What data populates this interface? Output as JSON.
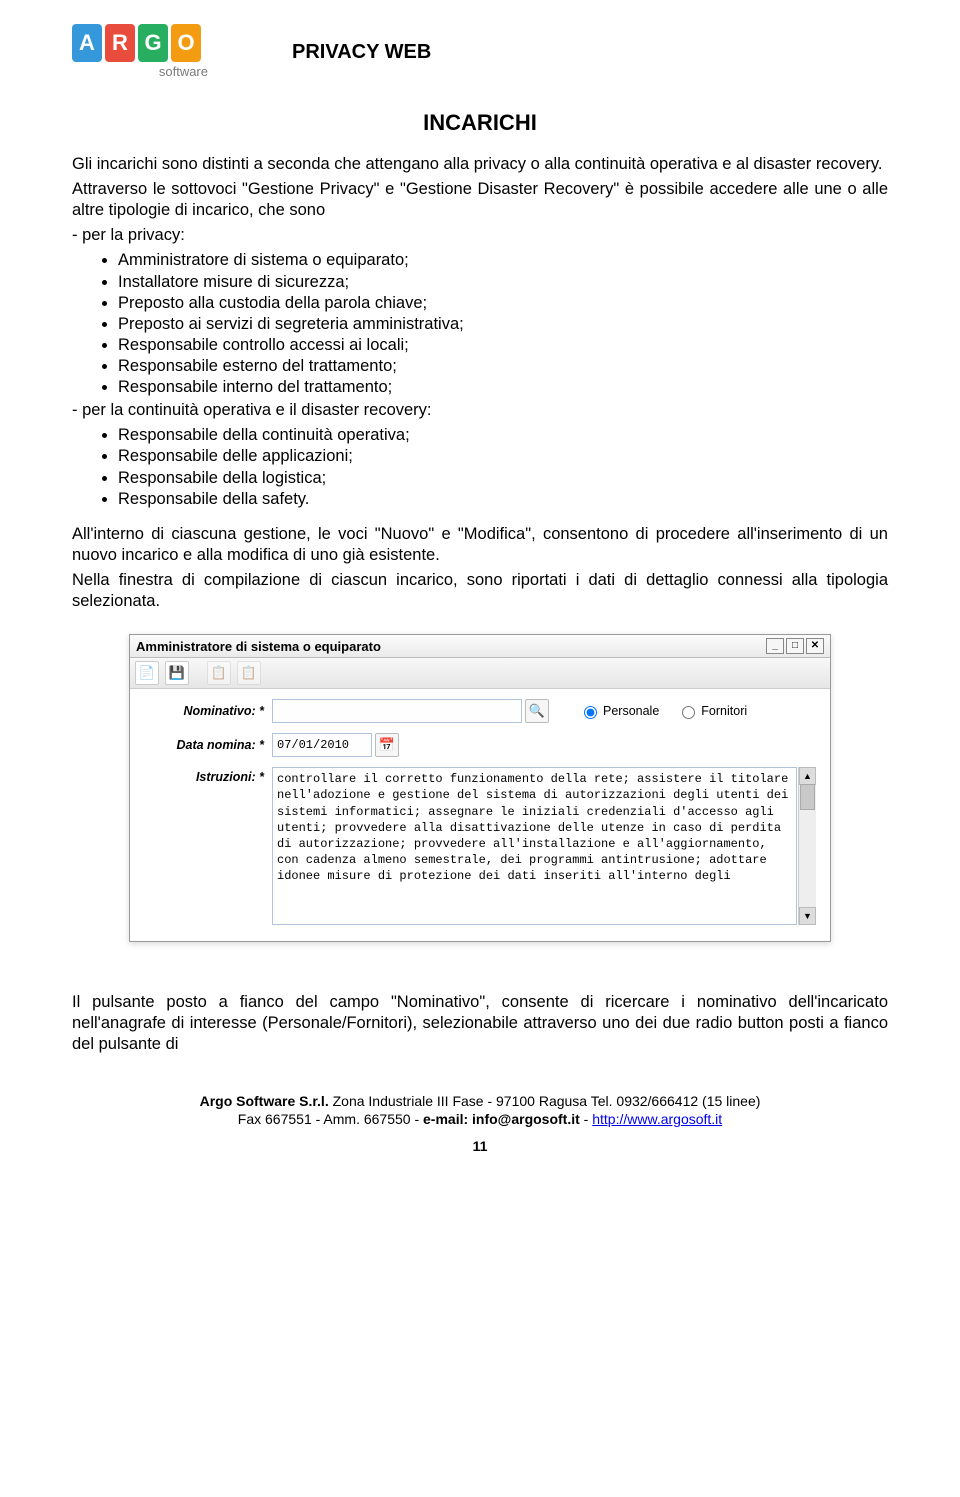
{
  "header": {
    "logo": {
      "a": "A",
      "r": "R",
      "g": "G",
      "o": "O",
      "sw": "software"
    },
    "title": "PRIVACY WEB"
  },
  "section_title": "INCARICHI",
  "p1": "Gli incarichi sono distinti a seconda che attengano alla privacy o alla  continuità operativa e al disaster recovery.",
  "p2_intro": "Attraverso le sottovoci \"Gestione Privacy\" e \"Gestione Disaster Recovery\" è possibile accedere alle une o alle altre tipologie di incarico, che sono",
  "p2_sub1": "- per la privacy:",
  "list_privacy": [
    "Amministratore di sistema o equiparato;",
    "Installatore misure di sicurezza;",
    "Preposto alla custodia della parola chiave;",
    "Preposto ai servizi di segreteria amministrativa;",
    "Responsabile controllo accessi ai locali;",
    "Responsabile esterno del trattamento;",
    "Responsabile interno del trattamento;"
  ],
  "p2_sub2": "- per la continuità operativa e il disaster recovery:",
  "list_dr": [
    "Responsabile della continuità operativa;",
    "Responsabile delle applicazioni;",
    "Responsabile della logistica;",
    "Responsabile della safety."
  ],
  "p3": "All'interno di ciascuna gestione, le voci \"Nuovo\" e \"Modifica\", consentono di procedere all'inserimento di un nuovo incarico e alla modifica di uno già esistente.",
  "p4": "Nella finestra di compilazione di ciascun incarico,  sono riportati i dati di dettaglio connessi alla tipologia selezionata.",
  "dialog": {
    "title": "Amministratore di sistema o equiparato",
    "toolbar_icons": {
      "new": "📄",
      "save": "💾",
      "tb3": "📋",
      "tb4": "📋"
    },
    "labels": {
      "nominativo": "Nominativo: *",
      "data": "Data nomina: *",
      "istruzioni": "Istruzioni: *"
    },
    "search_icon": "🔍",
    "cal_icon": "📅",
    "radio": {
      "personale": "Personale",
      "fornitori": "Fornitori"
    },
    "data_value": "07/01/2010",
    "istruzioni_text": "controllare il corretto funzionamento della rete; assistere il titolare nell'adozione e gestione del sistema di autorizzazioni degli utenti dei sistemi informatici; assegnare le iniziali credenziali d'accesso agli utenti; provvedere alla disattivazione  delle utenze in caso di perdita di autorizzazione; provvedere all'installazione e all'aggiornamento, con cadenza almeno semestrale, dei programmi antintrusione; adottare idonee misure di protezione dei dati inseriti all'interno degli"
  },
  "p5": "Il pulsante posto a fianco del campo \"Nominativo\", consente di ricercare i nominativo dell'incaricato nell'anagrafe di interesse (Personale/Fornitori), selezionabile  attraverso uno dei due radio button posti a fianco del pulsante di",
  "footer": {
    "line1a": "Argo Software S.r.l.",
    "line1b": " Zona Industriale III Fase - 97100 Ragusa Tel. 0932/666412 (15 linee)",
    "line2a": "Fax 667551 - Amm. 667550 - ",
    "line2b": "e-mail: info@argosoft.it",
    "line2c": " - ",
    "line2link": "http://www.argosoft.it"
  },
  "page_number": "11"
}
